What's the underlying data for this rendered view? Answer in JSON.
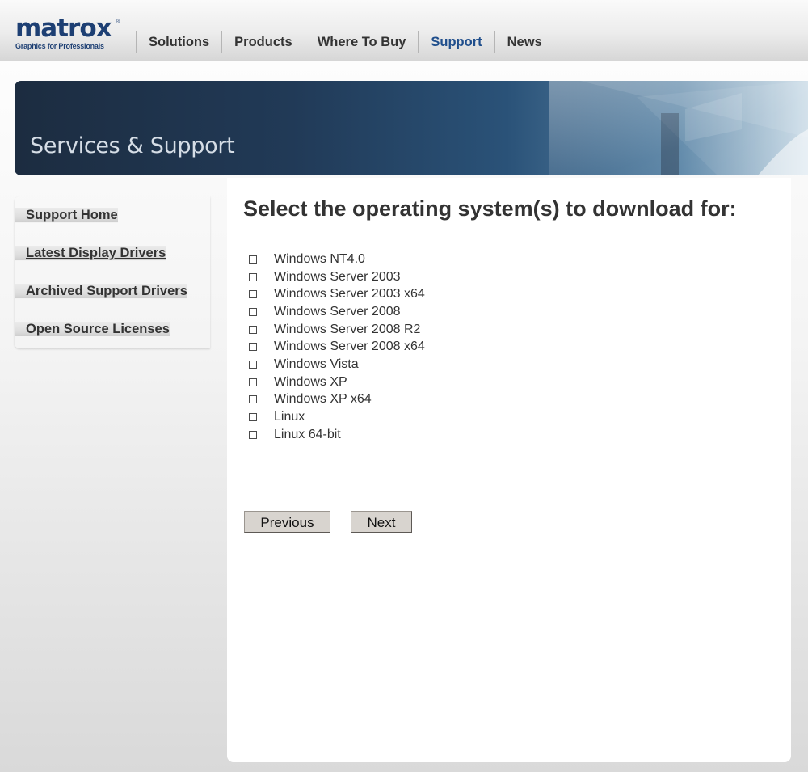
{
  "logo": {
    "word": "matrox",
    "registered": "®",
    "tagline": "Graphics for Professionals"
  },
  "nav": {
    "items": [
      {
        "label": "Solutions",
        "active": false
      },
      {
        "label": "Products",
        "active": false
      },
      {
        "label": "Where To Buy",
        "active": false
      },
      {
        "label": "Support",
        "active": true
      },
      {
        "label": "News",
        "active": false
      }
    ]
  },
  "banner": {
    "title": "Services & Support"
  },
  "sidebar": {
    "items": [
      {
        "label": "Support Home"
      },
      {
        "label": "Latest Display Drivers",
        "current": true
      },
      {
        "label": "Archived Support Drivers"
      },
      {
        "label": "Open Source Licenses"
      }
    ]
  },
  "main": {
    "title": "Select the operating system(s) to download for:",
    "os_options": [
      {
        "label": "Windows NT4.0",
        "checked": false
      },
      {
        "label": "Windows Server 2003",
        "checked": false
      },
      {
        "label": "Windows Server 2003 x64",
        "checked": false
      },
      {
        "label": "Windows Server 2008",
        "checked": false
      },
      {
        "label": "Windows Server 2008 R2",
        "checked": false
      },
      {
        "label": "Windows Server 2008 x64",
        "checked": false
      },
      {
        "label": "Windows Vista",
        "checked": false
      },
      {
        "label": "Windows XP",
        "checked": false
      },
      {
        "label": "Windows XP x64",
        "checked": false
      },
      {
        "label": "Linux",
        "checked": false
      },
      {
        "label": "Linux 64-bit",
        "checked": false
      }
    ],
    "previous_label": "Previous",
    "next_label": "Next"
  },
  "colors": {
    "brand": "#1d3f73",
    "nav_active": "#1f4e8c",
    "text": "#333333"
  }
}
